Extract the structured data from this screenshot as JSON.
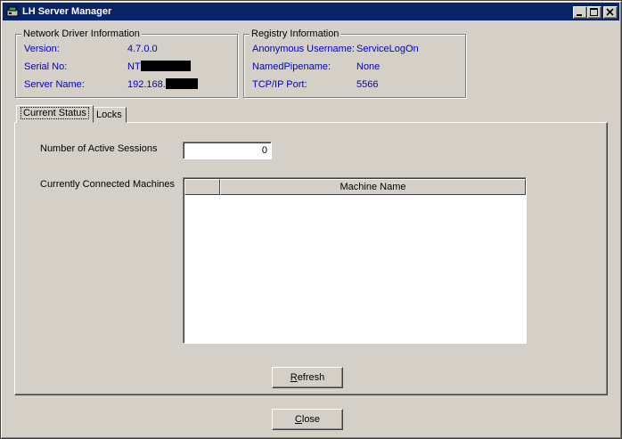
{
  "window": {
    "title": "LH Server Manager",
    "icon": "server-app-icon",
    "controls": [
      "minimize-icon",
      "maximize-icon",
      "close-icon"
    ]
  },
  "network_driver": {
    "legend": "Network Driver Information",
    "version_label": "Version:",
    "version_value": "4.7.0.0",
    "serial_label": "Serial No:",
    "serial_value_prefix": "NT",
    "server_label": "Server Name:",
    "server_value_prefix": "192.168."
  },
  "registry": {
    "legend": "Registry Information",
    "anon_label": "Anonymous Username:",
    "anon_value": "ServiceLogOn",
    "pipe_label": "NamedPipename:",
    "pipe_value": "None",
    "port_label": "TCP/IP Port:",
    "port_value": "5566"
  },
  "tabs": {
    "current_status": "Current Status",
    "locks": "Locks"
  },
  "status": {
    "active_sessions_label": "Number of Active Sessions",
    "active_sessions_value": "0",
    "connected_label": "Currently Connected Machines",
    "columns": [
      "",
      "Machine Name"
    ]
  },
  "buttons": {
    "refresh_rest": "efresh",
    "refresh_mnemonic": "R",
    "close_rest": "lose",
    "close_mnemonic": "C"
  },
  "colors": {
    "titlebar": "#0a246a",
    "face": "#d4d0c8",
    "value_text": "#0000cc"
  }
}
